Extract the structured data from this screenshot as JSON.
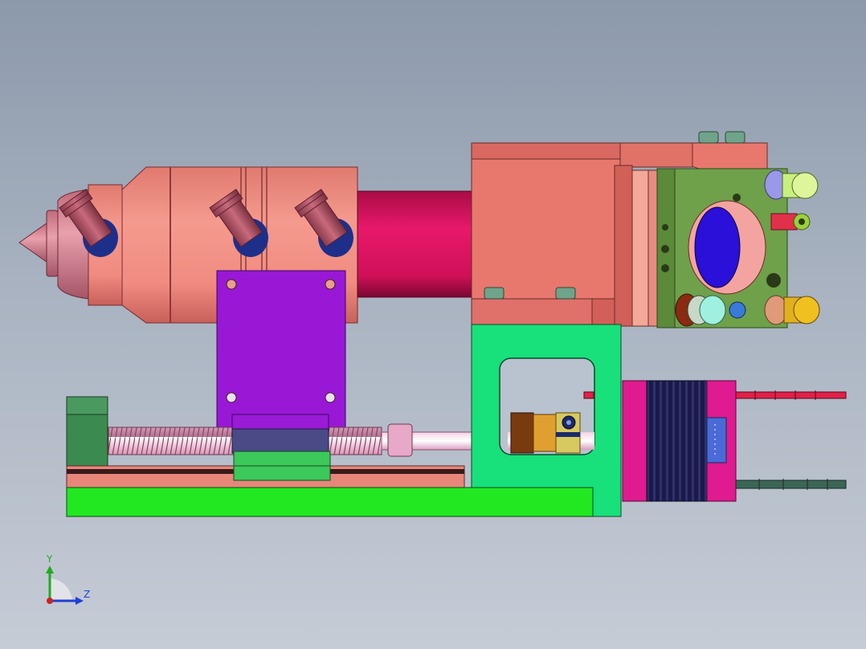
{
  "viewport": {
    "background_top": "#8c99ab",
    "background_bottom": "#c6ccd6"
  },
  "axis_triad": {
    "y_label": "Y",
    "z_label": "Z",
    "y_color": "#22aa22",
    "z_color": "#1f3fd6",
    "origin_color": "#cc2222"
  },
  "colors": {
    "nozzle_body": "#f08b80",
    "nozzle_tip": "#d97a8a",
    "barrel": "#e0145e",
    "port_fitting": "#b05566",
    "port_ring": "#203a9a",
    "motor_mount_block": "#e87a70",
    "mirror_plate": "#6fa04a",
    "mirror_lens": "#2a10d8",
    "carriage_plate": "#9a1ad6",
    "leadscrew": "#e8b4d0",
    "guide_block": "#3cc85a",
    "base_rail": "#22e822",
    "frame_bracket": "#18e07a",
    "stepper_motor": "#151540",
    "motor_end_cap": "#e01a90",
    "wire_red": "#e0204a",
    "wire_dark": "#3a6655",
    "coupler": "#d89a2a",
    "end_support": "#3b8a50"
  },
  "parts": [
    "nozzle",
    "barrel",
    "side-ports",
    "motor-mount-block",
    "mirror-mount",
    "carriage-plate",
    "leadscrew",
    "linear-guide",
    "base-rail",
    "frame-bracket",
    "shaft-coupler",
    "stepper-motor",
    "motor-wires"
  ]
}
